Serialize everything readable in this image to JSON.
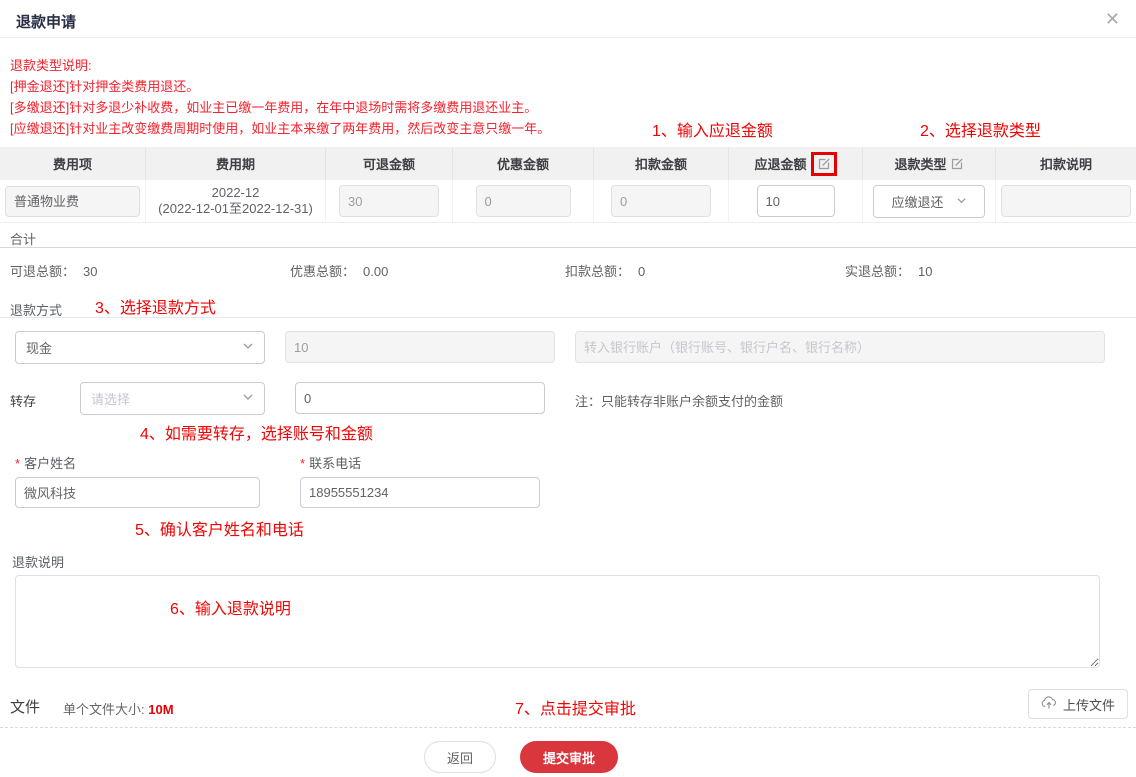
{
  "modal": {
    "title": "退款申请",
    "close_icon": "✕"
  },
  "refund_notes": {
    "heading": "退款类型说明:",
    "lines": [
      "[押金退还]针对押金类费用退还。",
      "[多缴退还]针对多退少补收费，如业主已缴一年费用，在年中退场时需将多缴费用退还业主。",
      "[应缴退还]针对业主改变缴费周期时使用，如业主本来缴了两年费用，然后改变主意只缴一年。"
    ]
  },
  "annotations": {
    "step1": "1、输入应退金额",
    "step2": "2、选择退款类型",
    "step3": "3、选择退款方式",
    "step4": "4、如需要转存，选择账号和金额",
    "step5": "5、确认客户姓名和电话",
    "step6": "6、输入退款说明",
    "step7": "7、点击提交审批"
  },
  "fee_table": {
    "headers": {
      "fee_item": "费用项",
      "fee_period": "费用期",
      "refundable_amount": "可退金额",
      "discount_amount": "优惠金额",
      "deduction_amount": "扣款金额",
      "refund_due_amount": "应退金额",
      "refund_type": "退款类型",
      "deduction_note": "扣款说明"
    },
    "row": {
      "fee_item": "普通物业费",
      "fee_period_month": "2022-12",
      "fee_period_range": "(2022-12-01至2022-12-31)",
      "refundable_amount": "30",
      "discount_amount": "0",
      "deduction_amount": "0",
      "refund_due_amount": "10",
      "refund_type": "应缴退还",
      "deduction_note": ""
    }
  },
  "summary": {
    "title": "合计",
    "refundable_total_label": "可退总额：",
    "refundable_total": "30",
    "discount_total_label": "优惠总额：",
    "discount_total": "0.00",
    "deduction_total_label": "扣款总额：",
    "deduction_total": "0",
    "actual_total_label": "实退总额：",
    "actual_total": "10"
  },
  "payment": {
    "section_label": "退款方式",
    "method_value": "现金",
    "amount_value": "10",
    "bank_placeholder": "转入银行账户（银行账号、银行户名、银行名称）"
  },
  "transfer": {
    "label": "转存",
    "account_placeholder": "请选择",
    "amount_value": "0",
    "note": "注：只能转存非账户余额支付的金额"
  },
  "customer": {
    "required_mark": "*",
    "name_label": "客户姓名",
    "name_value": "微风科技",
    "phone_label": "联系电话",
    "phone_value": "18955551234"
  },
  "refund_description": {
    "label": "退款说明"
  },
  "attachments": {
    "label": "文件",
    "size_hint_prefix": "单个文件大小: ",
    "size_limit": "10M",
    "upload_button": "上传文件"
  },
  "footer": {
    "back_button": "返回",
    "submit_button": "提交审批"
  },
  "colors": {
    "accent_red": "#d9363e",
    "annotation_red": "#ee0505",
    "note_red": "#f5222d"
  }
}
